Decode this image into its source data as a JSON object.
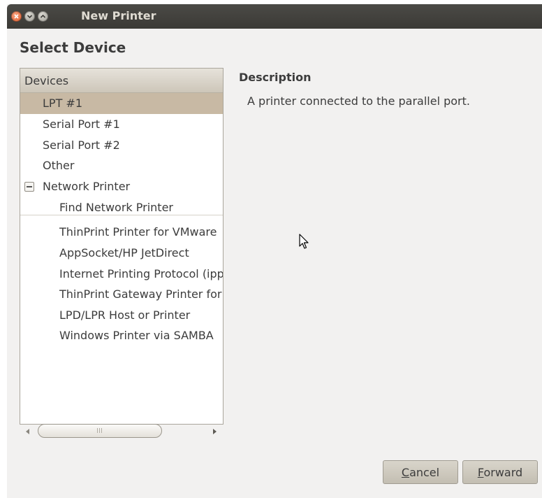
{
  "window": {
    "title": "New Printer",
    "controls": [
      "close-icon",
      "minimize-icon",
      "maximize-icon"
    ]
  },
  "heading": "Select Device",
  "devices": {
    "header": "Devices",
    "items": [
      {
        "label": "LPT #1",
        "selected": true
      },
      {
        "label": "Serial Port #1"
      },
      {
        "label": "Serial Port #2"
      },
      {
        "label": "Other"
      },
      {
        "label": "Network Printer",
        "expanded": true
      },
      {
        "label": "Find Network Printer"
      },
      {
        "label": "ThinPrint Printer for VMware"
      },
      {
        "label": "AppSocket/HP JetDirect"
      },
      {
        "label": "Internet Printing Protocol (ipp)"
      },
      {
        "label": "ThinPrint Gateway Printer for"
      },
      {
        "label": "LPD/LPR Host or Printer"
      },
      {
        "label": "Windows Printer via SAMBA"
      }
    ]
  },
  "description": {
    "title": "Description",
    "text": "A printer connected to the parallel port."
  },
  "buttons": {
    "cancel": {
      "mnemonic": "C",
      "rest": "ancel"
    },
    "forward": {
      "mnemonic": "F",
      "rest": "orward"
    }
  },
  "colors": {
    "selection": "#c8b9a4",
    "titlebar": "#3c3b37",
    "window_bg": "#f2f1f0"
  }
}
